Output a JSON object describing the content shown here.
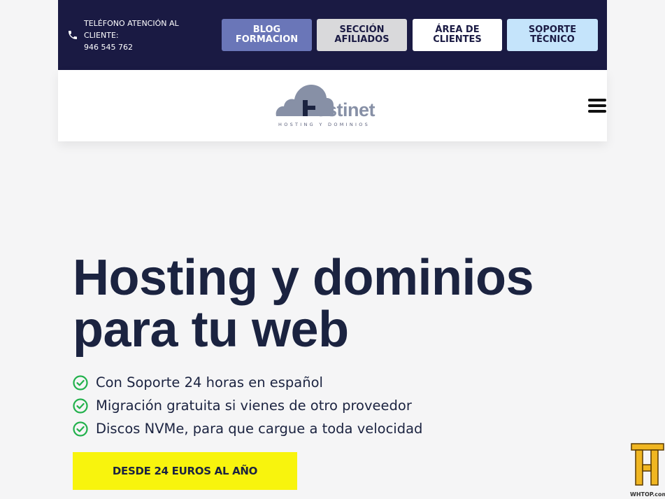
{
  "topbar": {
    "phone_label": "TELÉFONO ATENCIÓN AL CLIENTE:",
    "phone_number": "946 545 762",
    "buttons": [
      {
        "label": "BLOG FORMACION"
      },
      {
        "label": "SECCIÓN AFILIADOS"
      },
      {
        "label": "ÁREA DE CLIENTES"
      },
      {
        "label": "SOPORTE TÉCNICO"
      }
    ]
  },
  "logo": {
    "name": "Hostinet",
    "tagline": "HOSTING Y DOMINIOS"
  },
  "hero": {
    "title": "Hosting y dominios para tu web",
    "features": [
      "Con Soporte 24 horas en español",
      "Migración gratuita si vienes de otro proveedor",
      "Discos NVMe, para que cargue a toda velocidad"
    ],
    "cta_label": "DESDE 24 EUROS AL AÑO"
  },
  "watermark": {
    "text": "WHTOP.com"
  },
  "colors": {
    "topbar_bg": "#1a1a43",
    "title": "#1b2340",
    "cta_bg": "#f8f40d",
    "check_green": "#22b14c"
  },
  "icons": [
    "phone-icon",
    "check-circle-icon",
    "menu-icon",
    "cloud-logo-icon"
  ]
}
